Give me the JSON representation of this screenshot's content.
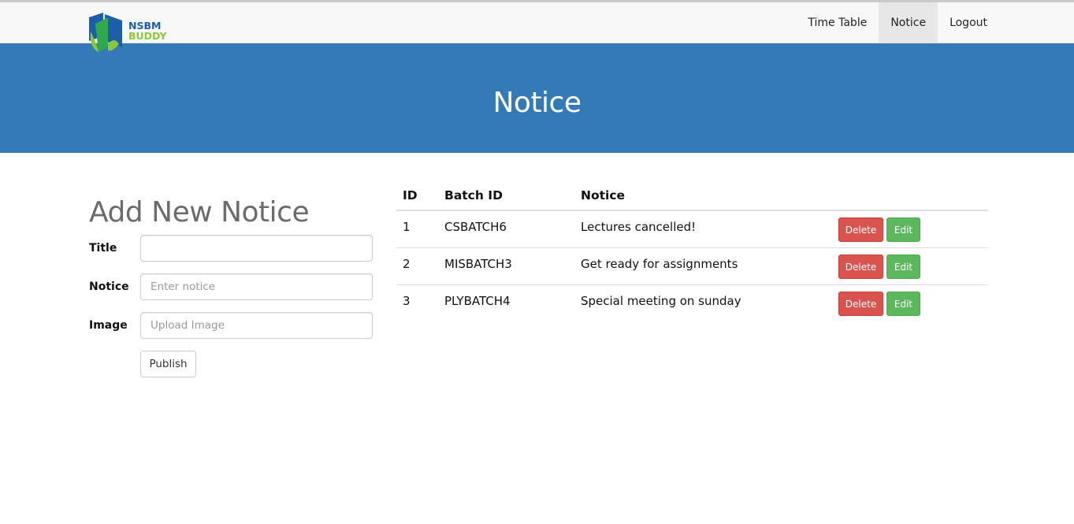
{
  "logo": {
    "line1": "NSBM",
    "line2": "BUDDY",
    "brand_blue": "#1d5ea8",
    "brand_green": "#8cc63f"
  },
  "nav": {
    "items": [
      {
        "label": "Time Table",
        "active": false
      },
      {
        "label": "Notice",
        "active": true
      },
      {
        "label": "Logout",
        "active": false
      }
    ]
  },
  "hero": {
    "title": "Notice",
    "color": "#337ab7"
  },
  "form": {
    "title": "Add New Notice",
    "title_field": {
      "label": "Title",
      "value": "",
      "placeholder": ""
    },
    "notice_field": {
      "label": "Notice",
      "value": "",
      "placeholder": "Enter notice"
    },
    "image_field": {
      "label": "Image",
      "value": "",
      "placeholder": "Upload Image"
    },
    "publish_label": "Publish"
  },
  "table": {
    "headers": [
      "ID",
      "Batch ID",
      "Notice",
      ""
    ],
    "rows": [
      {
        "id": "1",
        "batch": "CSBATCH6",
        "notice": "Lectures cancelled!"
      },
      {
        "id": "2",
        "batch": "MISBATCH3",
        "notice": "Get ready for assignments"
      },
      {
        "id": "3",
        "batch": "PLYBATCH4",
        "notice": "Special meeting on sunday"
      }
    ],
    "delete_label": "Delete",
    "edit_label": "Edit",
    "delete_color": "#d9534f",
    "edit_color": "#5cb85c"
  }
}
